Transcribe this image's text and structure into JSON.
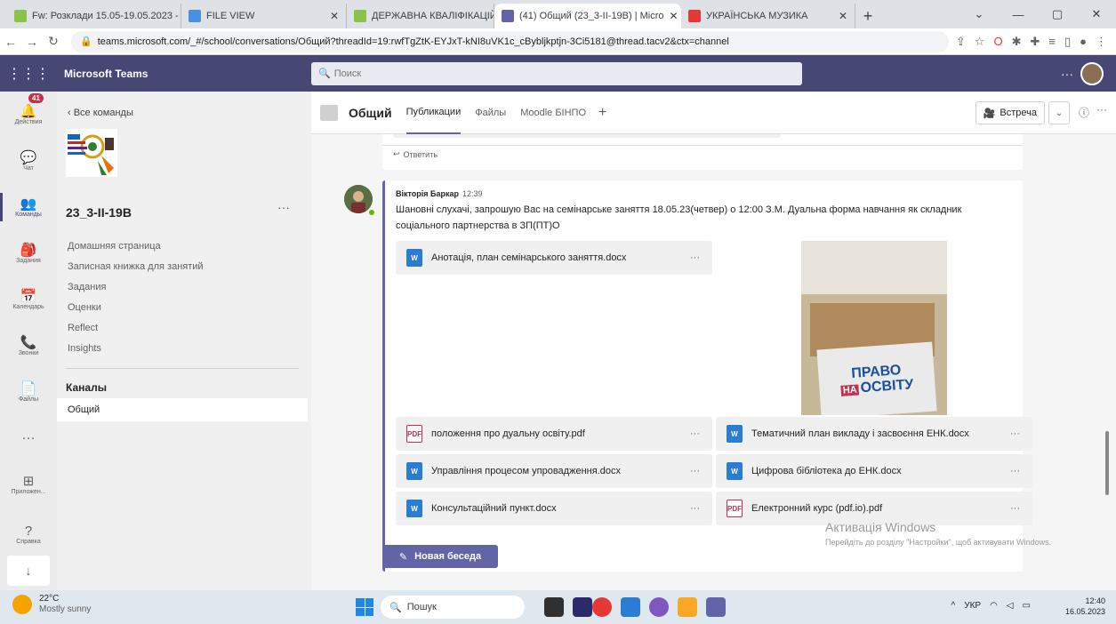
{
  "browser": {
    "tabs": [
      {
        "title": "Fw: Розклади 15.05-19.05.2023 -",
        "fav_color": "#8bc34a",
        "close": "✕"
      },
      {
        "title": "FILE VIEW",
        "fav_color": "#4a90e2",
        "close": ""
      },
      {
        "title": "ДЕРЖАВНА КВАЛІФІКАЦІЙНА",
        "fav_color": "#8bc34a",
        "close": "✕"
      },
      {
        "title": "(41) Общий (23_3-II-19В) | Micro",
        "fav_color": "#6264a7",
        "close": "✕"
      },
      {
        "title": "УКРАЇНСЬКА МУЗИКА",
        "fav_color": "#e53935",
        "close": "✕"
      }
    ],
    "new_tab": "+",
    "url": "teams.microsoft.com/_#/school/conversations/Общий?threadId=19:rwfTgZtK-EYJxT-kNI8uVK1c_cBybljkptjn-3Ci5181@thread.tacv2&ctx=channel",
    "window_controls": [
      "⌄",
      "—",
      "▢",
      "✕"
    ]
  },
  "teams": {
    "brand": "Microsoft Teams",
    "search_placeholder": "Поиск",
    "more": "···"
  },
  "rail": {
    "badge": "41",
    "items": [
      {
        "label": "Действия",
        "icon": "🔔"
      },
      {
        "label": "Чат",
        "icon": "💬"
      },
      {
        "label": "Команды",
        "icon": "👥"
      },
      {
        "label": "Задания",
        "icon": "🎒"
      },
      {
        "label": "Календарь",
        "icon": "📅"
      },
      {
        "label": "Звонки",
        "icon": "📞"
      },
      {
        "label": "Файлы",
        "icon": "📄"
      },
      {
        "label": "",
        "icon": "···"
      },
      {
        "label": "Приложен...",
        "icon": "⊞"
      }
    ],
    "help": {
      "label": "Справка",
      "icon": "?"
    },
    "download_icon": "↓"
  },
  "left_panel": {
    "back": "‹  Все команды",
    "team_name": "23_3-II-19В",
    "team_more": "···",
    "nav": [
      "Домашняя страница",
      "Записная книжка для занятий",
      "Задания",
      "Оценки",
      "Reflect",
      "Insights"
    ],
    "channels_header": "Каналы",
    "channel": "Общий"
  },
  "header": {
    "channel": "Общий",
    "tabs": [
      "Публикации",
      "Файлы",
      "Moodle БІНПО"
    ],
    "add_tab": "+",
    "meet_icon": "🎥",
    "meet_label": "Встреча",
    "dropdown": "⌄",
    "info": "ⓘ",
    "more": "···"
  },
  "feed": {
    "prev_reply": "Ответить",
    "post": {
      "author": "Вікторія Баркар",
      "time": "12:39",
      "message": "Шановні слухачі, запрошую Вас на семінарське заняття 18.05.23(четвер) о 12:00 З.М. Дуальна форма навчання як складник соціального партнерства в ЗП(ПТ)О",
      "photo_sign_line1": "ПРАВО",
      "photo_sign_na": "НА",
      "photo_sign_line2": "ОСВІТУ",
      "attachments": [
        {
          "name": "Анотація, план семінарського заняття.docx",
          "type": "w"
        },
        {
          "name": "положення про дуальну освіту.pdf",
          "type": "p"
        },
        {
          "name": "Тематичний план викладу і засвоєння ЕНК.docx",
          "type": "w"
        },
        {
          "name": "Управління процесом упровадження.docx",
          "type": "w"
        },
        {
          "name": "Цифрова бібліотека до ЕНК.docx",
          "type": "w"
        },
        {
          "name": "Консультаційний пункт.docx",
          "type": "w"
        },
        {
          "name": "Електронний курс (pdf.io).pdf",
          "type": "p"
        }
      ],
      "dots": "···"
    },
    "new_conversation": "Новая беседа"
  },
  "watermark": {
    "title": "Активація Windows",
    "text": "Перейдіть до розділу \"Настройки\", щоб активувати Windows."
  },
  "taskbar": {
    "temp": "22°C",
    "condition": "Mostly sunny",
    "search": "Пошук",
    "tray_up": "^",
    "lang": "УКР",
    "time": "12:40",
    "date": "16.05.2023"
  }
}
